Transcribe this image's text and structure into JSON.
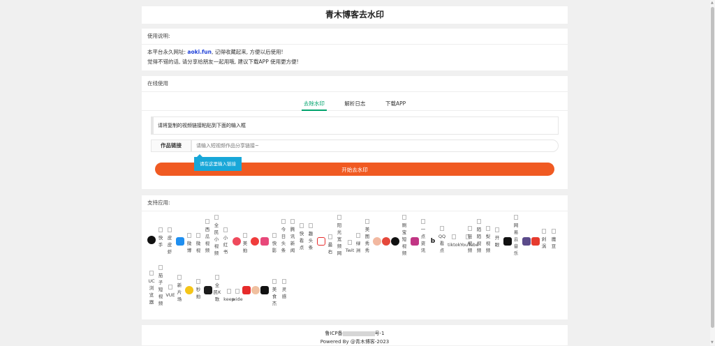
{
  "header": {
    "title": "青木博客去水印"
  },
  "instructions": {
    "section_title": "使用说明:",
    "line1_prefix": "本平台永久网址: ",
    "url": "aoki.fun",
    "line1_suffix": ", 记得收藏起来, 方便以后使用!",
    "line2": "觉得不错的话, 请分享给朋友一起用哦, 建议下载APP 使用更方便!"
  },
  "online": {
    "section_title": "在线使用",
    "tabs": [
      {
        "label": "去除水印",
        "active": true
      },
      {
        "label": "解析日志",
        "active": false
      },
      {
        "label": "下载APP",
        "active": false
      }
    ],
    "notice": "请将复制的视频链接粘贴到下面的输入框",
    "input_label": "作品链接",
    "input_placeholder": "请输入短视频作品分享链接~",
    "tooltip": "请在这里输入链接",
    "submit_label": "开始去水印"
  },
  "supported": {
    "section_title": "支持应用:",
    "apps": [
      "快手",
      "皮皮虾",
      "微博",
      "微视",
      "西瓜视频",
      "全民小视频",
      "小红书",
      "美拍",
      "快影",
      "今日头条",
      "腾讯新闻",
      "快看点",
      "趣头条",
      "最右",
      "阳光宽频网",
      "Twit",
      "绿洲",
      "美图秀秀",
      "刷宝短视频",
      "一点资讯",
      "QQ看点",
      "tiktok",
      "YouTube",
      "轻视频",
      "陌陌视频",
      "梨视频",
      "开眼",
      "网易云音乐",
      "剁涡",
      "魔豆",
      "UC浏览器",
      "茄子短视频",
      "VUE",
      "新片场",
      "秒拍",
      "全民K歌",
      "keep",
      "wide",
      "美食杰",
      "灵感"
    ]
  },
  "footer": {
    "icp_prefix": "鲁ICP备",
    "icp_suffix": "号-1",
    "powered": "Powered By @青木博客-2023"
  },
  "colors": {
    "accent": "#00a36c",
    "button": "#f05a22",
    "link": "#1e40d8",
    "tooltip": "#18a7d8"
  }
}
